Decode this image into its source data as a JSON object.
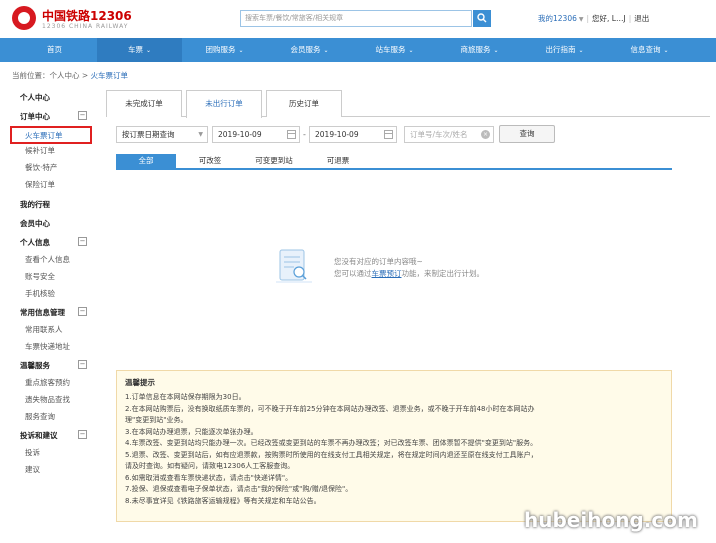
{
  "header": {
    "logo_cn": "中国铁路12306",
    "logo_en": "12306 CHINA RAILWAY",
    "search_placeholder": "搜索车票/餐饮/常旅客/相关规章",
    "my_12306": "我的12306",
    "greeting": "您好, L…J",
    "logout": "退出"
  },
  "nav": [
    {
      "label": "首页",
      "caret": false
    },
    {
      "label": "车票",
      "caret": true,
      "active": true
    },
    {
      "label": "团购服务",
      "caret": true
    },
    {
      "label": "会员服务",
      "caret": true
    },
    {
      "label": "站车服务",
      "caret": true
    },
    {
      "label": "商旅服务",
      "caret": true
    },
    {
      "label": "出行指南",
      "caret": true
    },
    {
      "label": "信息查询",
      "caret": true
    }
  ],
  "breadcrumb": {
    "prefix": "当前位置：个人中心 > ",
    "current": "火车票订单"
  },
  "sidebar": {
    "personal_center": "个人中心",
    "order_center": "订单中心",
    "order_items": [
      "火车票订单",
      "候补订单",
      "餐饮·特产",
      "保险订单"
    ],
    "my_trips": "我的行程",
    "member_center": "会员中心",
    "personal_info": "个人信息",
    "personal_items": [
      "查看个人信息",
      "账号安全",
      "手机核验"
    ],
    "common_info": "常用信息管理",
    "common_items": [
      "常用联系人",
      "车票快递地址"
    ],
    "warm_service": "温馨服务",
    "warm_items": [
      "重点旅客预约",
      "遗失物品查找",
      "服务查询"
    ],
    "complaints": "投诉和建议",
    "complaint_items": [
      "投诉",
      "建议"
    ]
  },
  "tabs": [
    "未完成订单",
    "未出行订单",
    "历史订单"
  ],
  "filter": {
    "query_type": "按订票日期查询",
    "start_date": "2019-10-09",
    "end_date": "2019-10-09",
    "order_placeholder": "订单号/车次/姓名",
    "query_button": "查询"
  },
  "subtabs": [
    "全部",
    "可改签",
    "可变更到站",
    "可退票"
  ],
  "empty": {
    "line1": "您没有对应的订单内容哦~",
    "line2_prefix": "您可以通过",
    "line2_link": "车票预订",
    "line2_suffix": "功能，来制定出行计划。"
  },
  "tips": {
    "title": "温馨提示",
    "items": [
      "1.订单信息在本网站保存期限为30日。",
      "2.在本网站购票后，没有换取纸质车票的，可不晚于开车前25分钟在本网站办理改签、退票业务，或不晚于开车前48小时在本网站办",
      "理\"变更到站\"业务。",
      "3.在本网站办理退票，只能逐次单张办理。",
      "4.车票改签、变更到站均只能办理一次。已经改签或变更到站的车票不再办理改签；对已改签车票、团体票暂不提供\"变更到站\"服务。",
      "5.退票、改签、变更到站后，如有应退票款，按购票时所使用的在线支付工具相关规定，将在规定时间内退还至原在线支付工具账户，",
      "请及时查询。如有疑问，请致电12306人工客服查询。",
      "6.如需取消或查看车票快递状态，请点击\"快递详情\"。",
      "7.投保、退保或查看电子保单状态，请点击\"我的保险\"或\"购/赠/退保险\"。",
      "8.未尽事宜详见《铁路旅客运输规程》等有关规定和车站公告。"
    ]
  },
  "watermark": "hubeihong.com"
}
